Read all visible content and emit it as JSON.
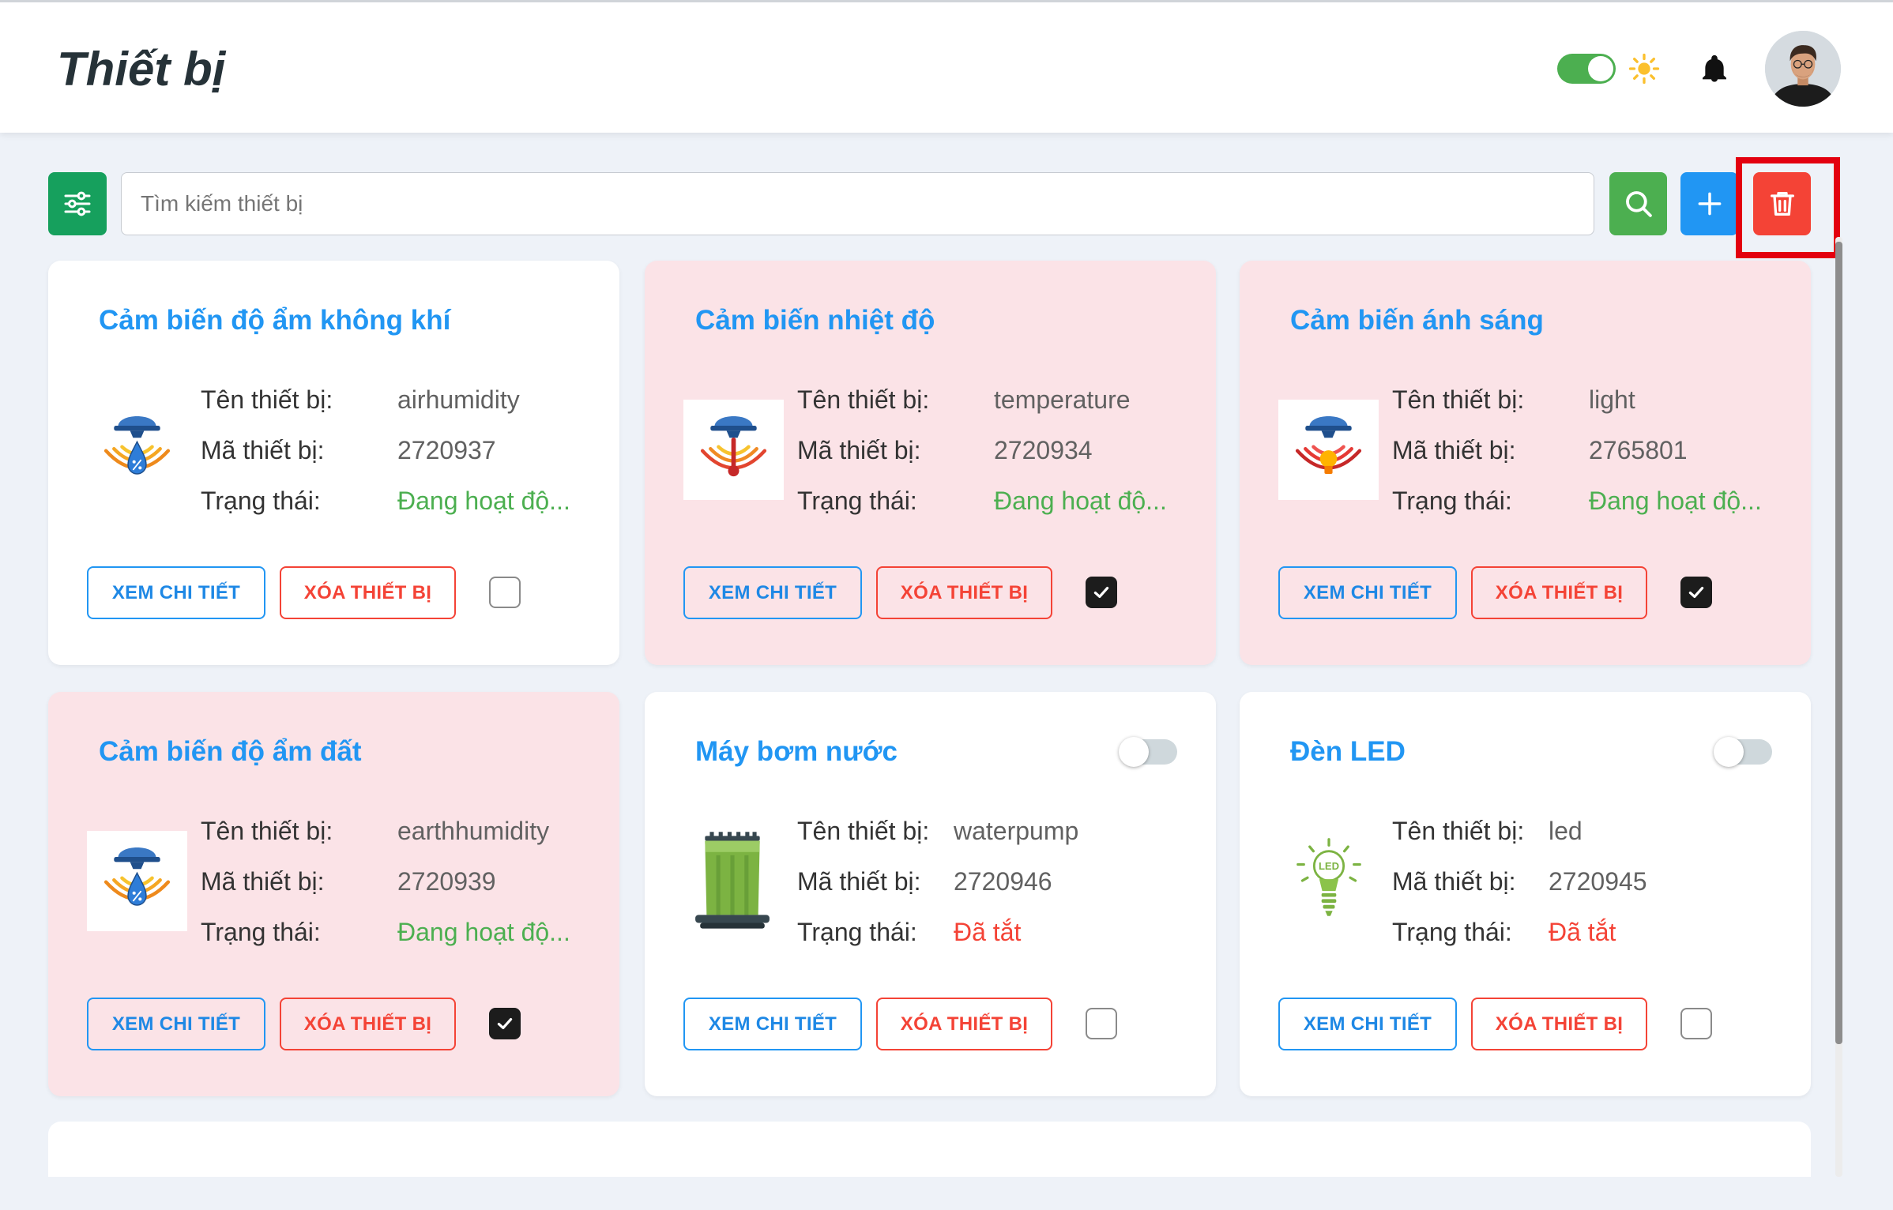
{
  "header": {
    "title": "Thiết bị",
    "theme_toggle_on": true,
    "theme_icon": "sun-icon",
    "notification_icon": "bell-icon",
    "avatar_icon": "user-avatar"
  },
  "toolbar": {
    "filter_icon": "sliders-icon",
    "search_placeholder": "Tìm kiếm thiết bị",
    "search_value": "",
    "search_icon": "search-icon",
    "add_icon": "plus-icon",
    "delete_icon": "trash-icon",
    "delete_highlighted": true
  },
  "labels": {
    "name": "Tên thiết bị:",
    "code": "Mã thiết bị:",
    "status": "Trạng thái:",
    "view_button": "XEM CHI TIẾT",
    "delete_button": "XÓA THIẾT BỊ"
  },
  "colors": {
    "accent": "#2196f3",
    "active_status": "#4caf50",
    "off_status": "#f44336",
    "selected_card": "#fbe3e7",
    "filter_button": "#16a05d",
    "search_button": "#4caf50",
    "add_button": "#2196f3",
    "delete_button": "#f44336",
    "highlight_box": "#e3000f"
  },
  "devices": [
    {
      "title": "Cảm biến độ ẩm không khí",
      "name": "airhumidity",
      "code": "2720937",
      "status": "Đang hoạt độ...",
      "status_type": "active",
      "selected": false,
      "has_power_toggle": false,
      "icon": "humidity-sensor-icon"
    },
    {
      "title": "Cảm biến nhiệt độ",
      "name": "temperature",
      "code": "2720934",
      "status": "Đang hoạt độ...",
      "status_type": "active",
      "selected": true,
      "has_power_toggle": false,
      "icon": "temperature-sensor-icon"
    },
    {
      "title": "Cảm biến ánh sáng",
      "name": "light",
      "code": "2765801",
      "status": "Đang hoạt độ...",
      "status_type": "active",
      "selected": true,
      "has_power_toggle": false,
      "icon": "light-sensor-icon"
    },
    {
      "title": "Cảm biến độ ẩm đất",
      "name": "earthhumidity",
      "code": "2720939",
      "status": "Đang hoạt độ...",
      "status_type": "active",
      "selected": true,
      "has_power_toggle": false,
      "icon": "soil-humidity-sensor-icon"
    },
    {
      "title": "Máy bơm nước",
      "name": "waterpump",
      "code": "2720946",
      "status": "Đã tắt",
      "status_type": "off",
      "selected": false,
      "has_power_toggle": true,
      "power_on": false,
      "icon": "water-pump-icon"
    },
    {
      "title": "Đèn LED",
      "name": "led",
      "code": "2720945",
      "status": "Đã tắt",
      "status_type": "off",
      "selected": false,
      "has_power_toggle": true,
      "power_on": false,
      "icon": "led-bulb-icon",
      "icon_text": "LED"
    }
  ]
}
